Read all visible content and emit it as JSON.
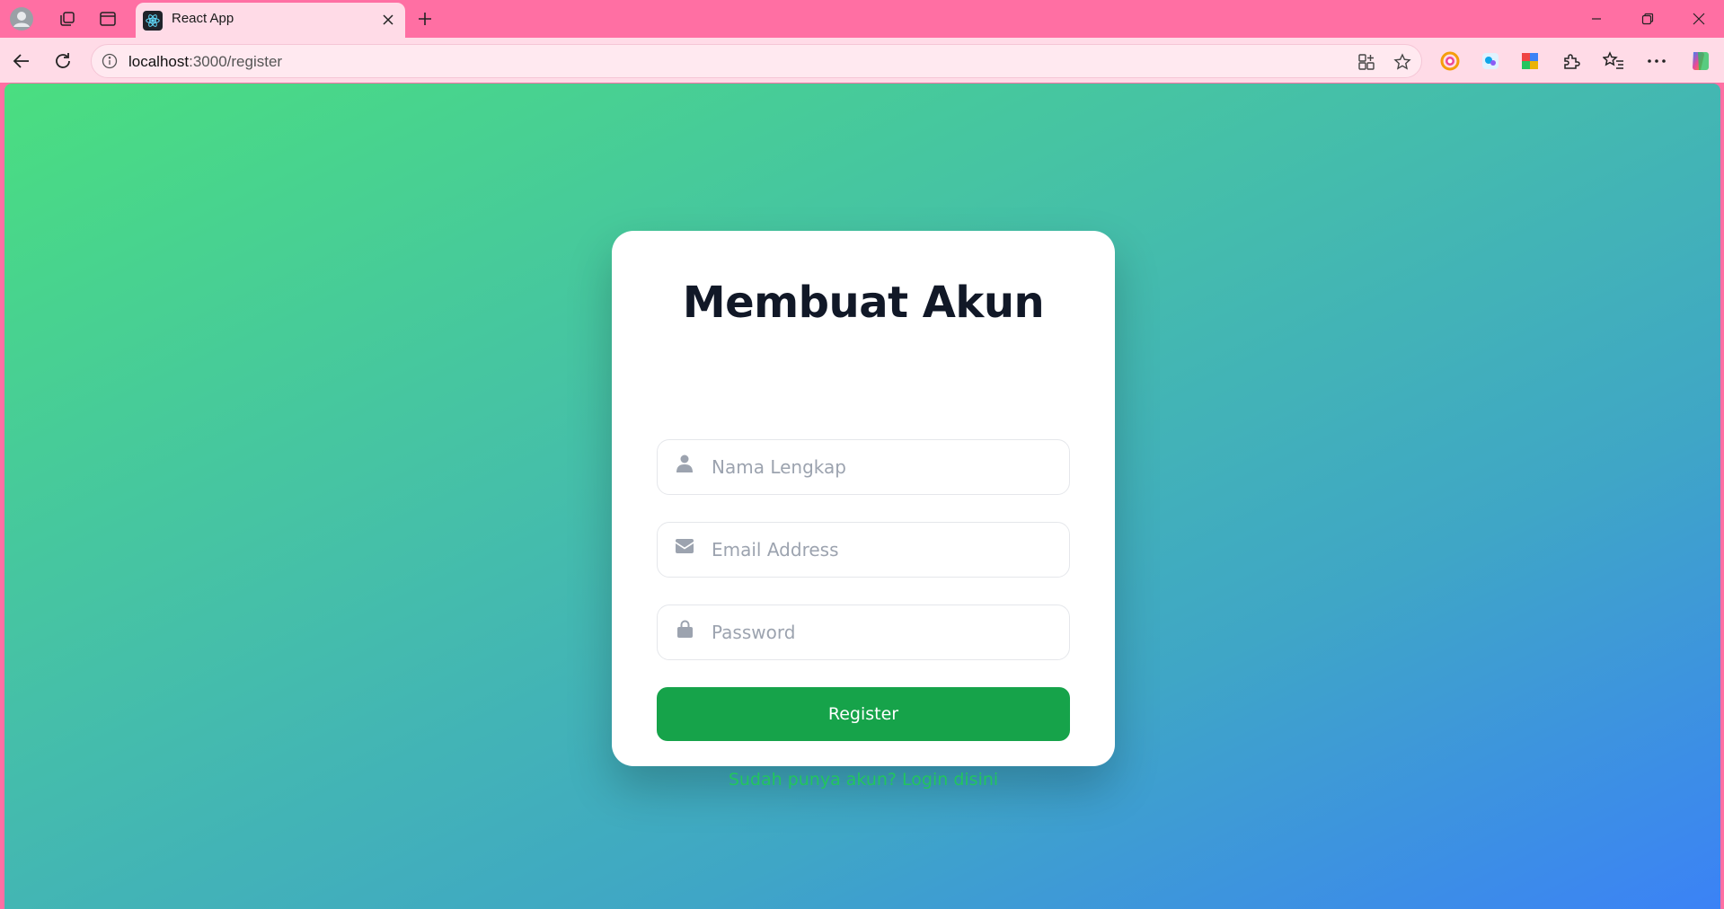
{
  "browser": {
    "tab_title": "React App",
    "url_host": "localhost",
    "url_path": ":3000/register"
  },
  "page": {
    "title": "Membuat Akun",
    "fields": {
      "name_placeholder": "Nama Lengkap",
      "name_value": "",
      "email_placeholder": "Email Address",
      "email_value": "",
      "password_placeholder": "Password",
      "password_value": ""
    },
    "register_label": "Register",
    "login_link": "Sudah punya akun? Login disini"
  },
  "colors": {
    "tabstrip": "#ff6fa3",
    "toolbar": "#ffdbe7",
    "gradient_start": "#4ade80",
    "gradient_end": "#3b82f6",
    "button": "#16a34a",
    "link": "#22c55e",
    "title": "#111827"
  },
  "icons": {
    "name_field": "user-icon",
    "email_field": "envelope-icon",
    "password_field": "lock-icon"
  }
}
